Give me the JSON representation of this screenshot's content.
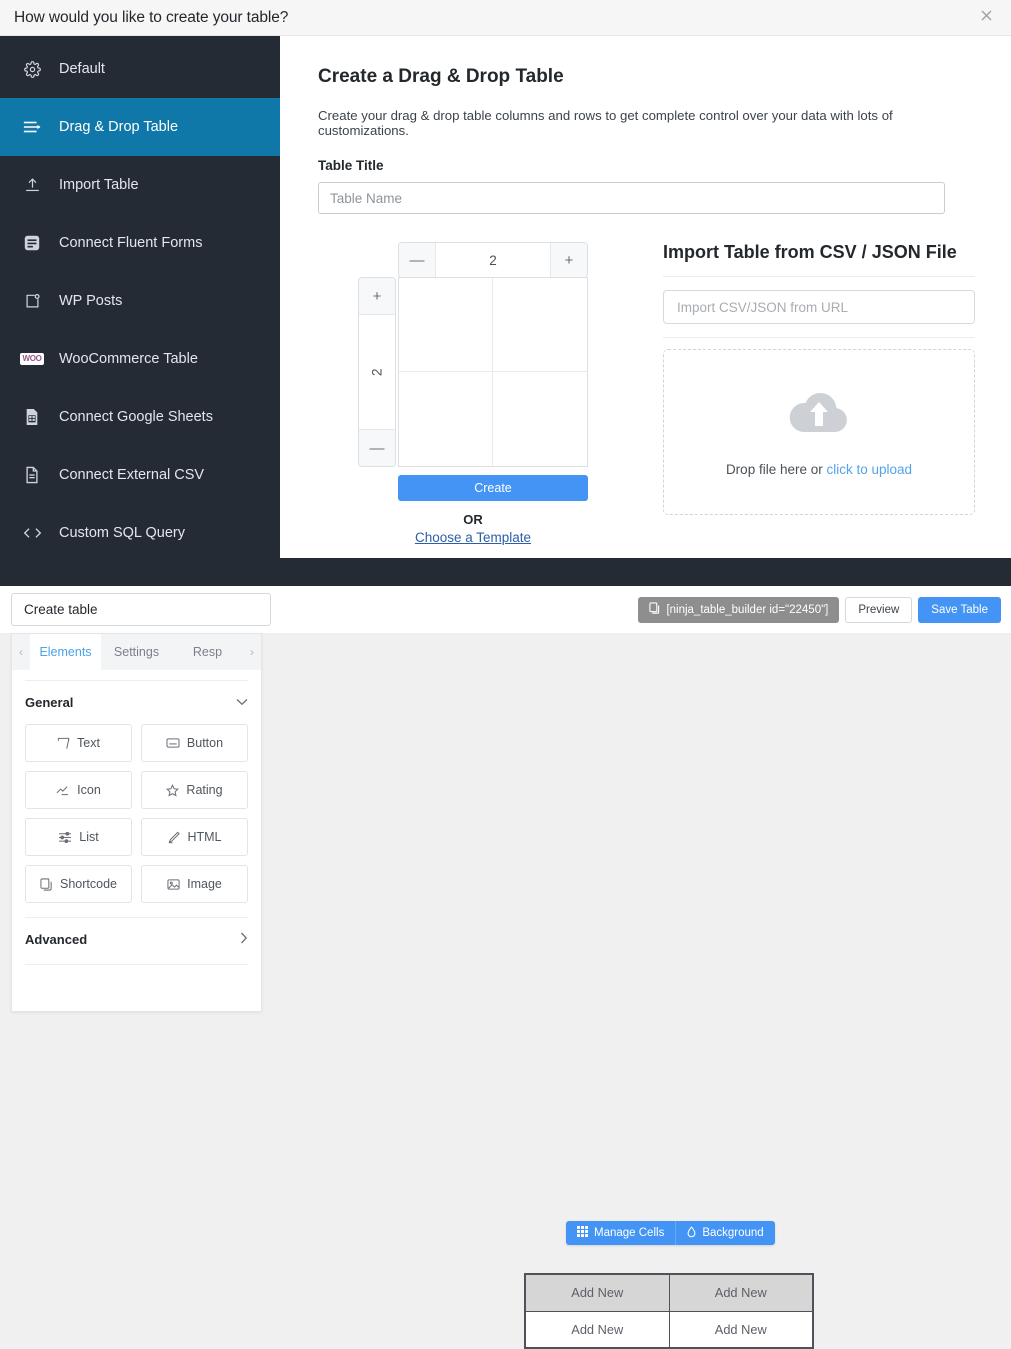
{
  "modal": {
    "title": "How would you like to create your table?",
    "close_icon": "close-icon"
  },
  "sidebar": {
    "items": [
      {
        "label": "Default",
        "icon": "gear-icon",
        "active": false
      },
      {
        "label": "Drag & Drop Table",
        "icon": "drag-drop-icon",
        "active": true
      },
      {
        "label": "Import Table",
        "icon": "upload-icon",
        "active": false
      },
      {
        "label": "Connect Fluent Forms",
        "icon": "form-icon",
        "active": false
      },
      {
        "label": "WP Posts",
        "icon": "posts-icon",
        "active": false
      },
      {
        "label": "WooCommerce Table",
        "icon": "woocommerce-icon",
        "active": false
      },
      {
        "label": "Connect Google Sheets",
        "icon": "sheets-icon",
        "active": false
      },
      {
        "label": "Connect External CSV",
        "icon": "csv-file-icon",
        "active": false
      },
      {
        "label": "Custom SQL Query",
        "icon": "code-icon",
        "active": false
      }
    ]
  },
  "content": {
    "heading": "Create a Drag & Drop Table",
    "description": "Create your drag & drop table columns and rows to get complete control over your data with lots of customizations.",
    "table_title_label": "Table Title",
    "table_title_placeholder": "Table Name",
    "table_title_value": ""
  },
  "grid_picker": {
    "columns": "2",
    "rows": "2",
    "col_decrement": "—",
    "col_increment": "+",
    "row_increment": "+",
    "row_decrement": "—",
    "create_label": "Create",
    "or_label": "OR",
    "template_link": "Choose a Template"
  },
  "import": {
    "heading": "Import Table from CSV / JSON File",
    "url_placeholder": "Import CSV/JSON from URL",
    "url_value": "",
    "drop_text": "Drop file here or ",
    "drop_link": "click to upload",
    "upload_icon": "cloud-upload-icon"
  },
  "builder": {
    "table_name_value": "Create table",
    "table_name_placeholder": "Table Name",
    "shortcode": "[ninja_table_builder id=\"22450\"]",
    "shortcode_icon": "copy-icon",
    "preview_label": "Preview",
    "save_label": "Save Table"
  },
  "panel": {
    "prev_arrow": "‹",
    "next_arrow": "›",
    "tabs": [
      {
        "label": "Elements",
        "active": true
      },
      {
        "label": "Settings",
        "active": false
      },
      {
        "label": "Resp",
        "active": false
      }
    ],
    "general_label": "General",
    "general_chevron": "⌄",
    "elements": [
      {
        "label": "Text",
        "icon": "text-edit-icon"
      },
      {
        "label": "Button",
        "icon": "button-icon"
      },
      {
        "label": "Icon",
        "icon": "icon-glyph-icon"
      },
      {
        "label": "Rating",
        "icon": "star-icon"
      },
      {
        "label": "List",
        "icon": "list-icon"
      },
      {
        "label": "HTML",
        "icon": "pencil-icon"
      },
      {
        "label": "Shortcode",
        "icon": "shortcode-icon"
      },
      {
        "label": "Image",
        "icon": "image-icon"
      }
    ],
    "advanced_label": "Advanced",
    "advanced_chevron": "›"
  },
  "canvas": {
    "manage_cells_label": "Manage Cells",
    "manage_cells_icon": "grid-icon",
    "background_label": "Background",
    "background_icon": "droplet-icon",
    "table": {
      "header_row": [
        "Add New",
        "Add New"
      ],
      "body_row": [
        "Add New",
        "Add New"
      ]
    }
  },
  "colors": {
    "accent_blue": "#4394f5",
    "sidebar_active": "#1078a8",
    "sidebar_bg": "#242b35",
    "link_blue": "#2d5ea8",
    "upload_link": "#56a2e8"
  }
}
